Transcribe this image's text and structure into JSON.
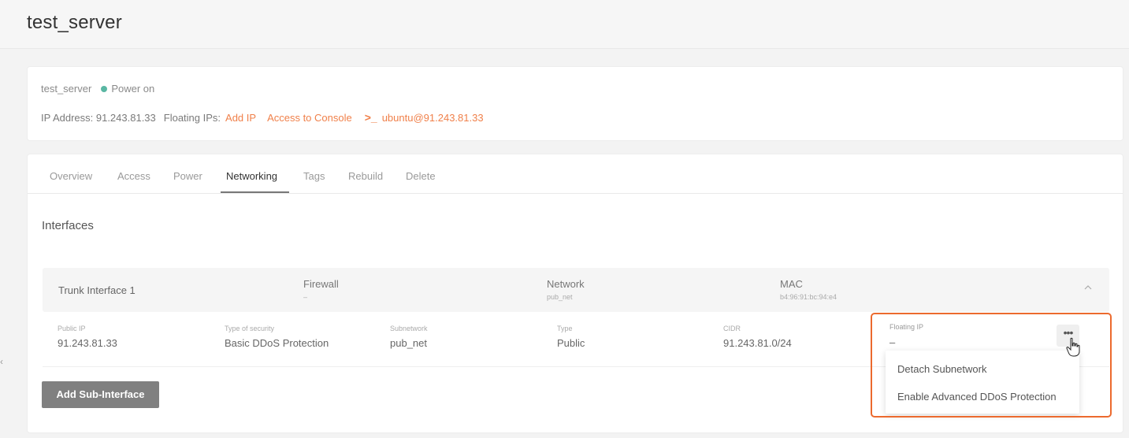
{
  "page": {
    "title": "test_server"
  },
  "summary": {
    "server_name": "test_server",
    "status": "Power on",
    "ip_label": "IP Address: 91.243.81.33",
    "floating_label": "Floating IPs:",
    "add_ip": "Add IP",
    "access_console": "Access to Console",
    "console_icon": ">_",
    "ssh_user": "ubuntu@91.243.81.33",
    "status_color": "#5ab7a3",
    "accent_color": "#f0804a"
  },
  "tabs": [
    "Overview",
    "Access",
    "Power",
    "Networking",
    "Tags",
    "Rebuild",
    "Delete"
  ],
  "active_tab": "Networking",
  "section": {
    "title": "Interfaces"
  },
  "interface": {
    "name": "Trunk Interface 1",
    "firewall_title": "Firewall",
    "firewall_value": "–",
    "network_title": "Network",
    "network_value": "pub_net",
    "mac_title": "MAC",
    "mac_value": "b4:96:91:bc:94:e4",
    "details": {
      "public_ip_label": "Public IP",
      "public_ip": "91.243.81.33",
      "security_label": "Type of security",
      "security": "Basic DDoS Protection",
      "subnetwork_label": "Subnetwork",
      "subnetwork": "pub_net",
      "type_label": "Type",
      "type": "Public",
      "cidr_label": "CIDR",
      "cidr": "91.243.81.0/24",
      "floating_ip_label": "Floating IP",
      "floating_ip": "–"
    }
  },
  "actions": {
    "add_sub_interface": "Add Sub-Interface",
    "more": "•••"
  },
  "dropdown": {
    "items": [
      "Detach Subnetwork",
      "Enable Advanced DDoS Protection"
    ]
  },
  "side": {
    "collapse_arrow": "‹"
  },
  "highlight_color": "#ec6a2e"
}
